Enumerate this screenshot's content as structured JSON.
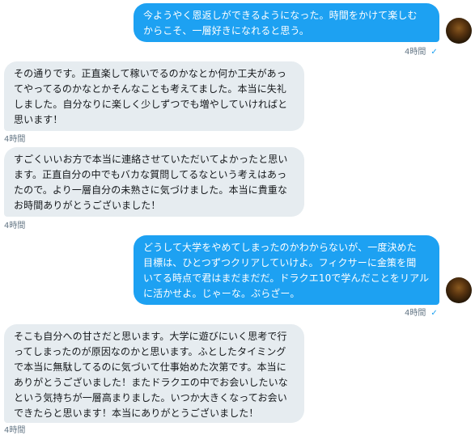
{
  "messages": [
    {
      "id": "m1",
      "direction": "outgoing",
      "text": "今ようやく恩返しができるようになった。時間をかけて楽しむ\nからこそ、一層好きになれると思う。",
      "time": "4時間",
      "read_receipt": "check-icon"
    },
    {
      "id": "m2",
      "direction": "incoming",
      "text": "その通りです。正直楽して稼いでるのかなとか何か工夫があっ\nてやってるのかなとかそんなことも考えてました。本当に失礼\nしました。自分なりに楽しく少しずつでも増やしていければと\n思います！",
      "time": "4時間"
    },
    {
      "id": "m3",
      "direction": "incoming",
      "text": "すごくいいお方で本当に連絡させていただいてよかったと思い\nます。正直自分の中でもバカな質問してるなという考えはあっ\nたので。より一層自分の未熟さに気づけました。本当に貴重な\nお時間ありがとうございました！",
      "time": "4時間"
    },
    {
      "id": "m4",
      "direction": "outgoing",
      "text": "どうして大学をやめてしまったのかわからないが、一度決めた\n目標は、ひとつずつクリアしていけよ。フィクサーに金策を聞\nいてる時点で君はまだまだだ。ドラクエ10で学んだことをリアル\nに活かせよ。じゃーな。ぶらざー。",
      "time": "4時間",
      "read_receipt": "check-icon"
    },
    {
      "id": "m5",
      "direction": "incoming",
      "text": "そこも自分への甘さだと思います。大学に遊びにいく思考で行\nってしまったのが原因なのかと思います。ふとしたタイミング\nで本当に無駄してるのに気づいて仕事始めた次第です。本当に\nありがとうございました！またドラクエの中でお会いしたいな\nという気持ちが一層高まりました。いつか大きくなってお会い\nできたらと思います！本当にありがとうございました！",
      "time": "4時間"
    }
  ],
  "colors": {
    "outgoing_bubble": "#1da1f2",
    "incoming_bubble": "#e6ecf0",
    "meta_text": "#657786"
  }
}
